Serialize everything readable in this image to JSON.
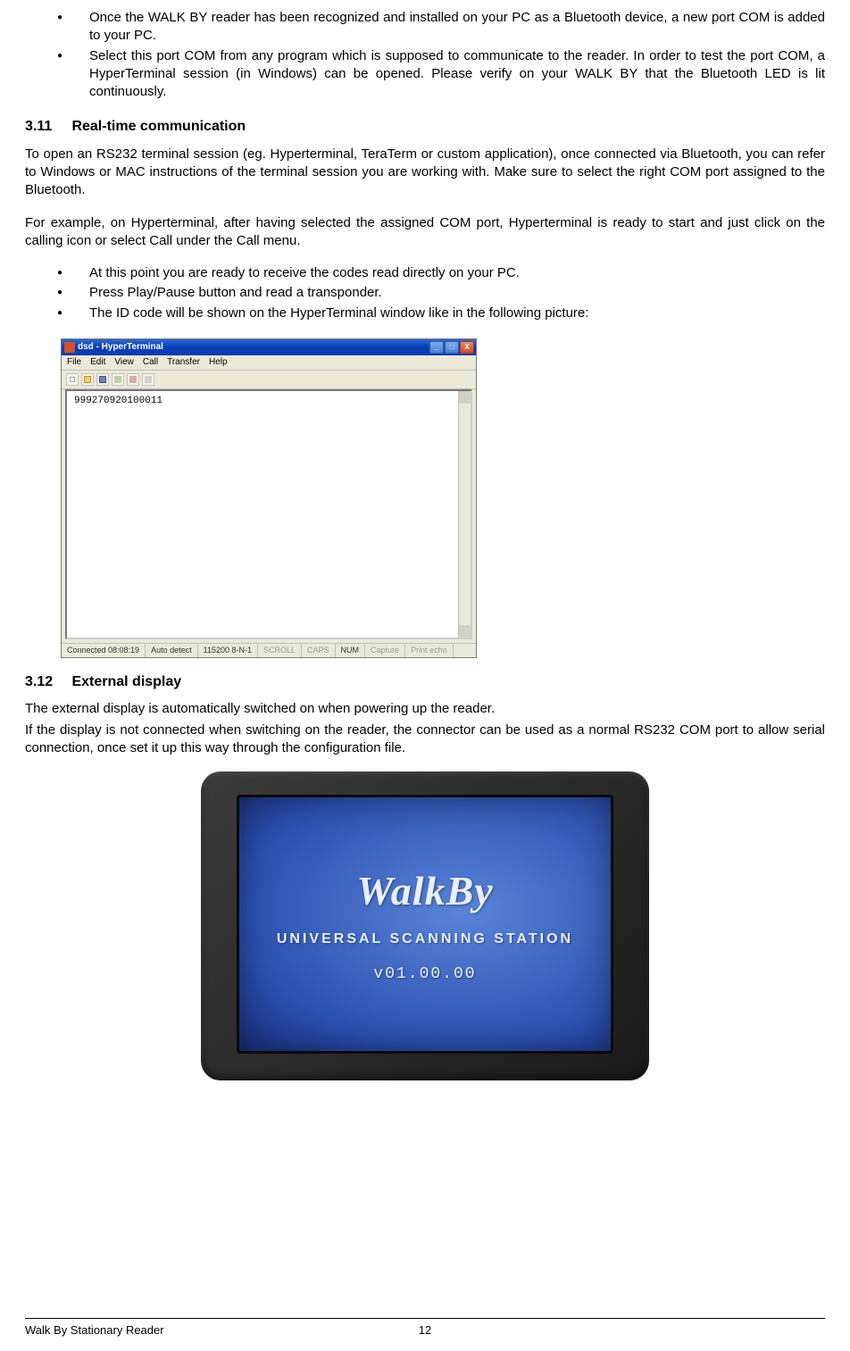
{
  "top_bullets": [
    "Once the WALK BY reader has been recognized and installed on your PC as a Bluetooth device, a new port COM is added to your PC.",
    "Select this port COM from any program which is supposed to communicate to the reader. In order to test the port COM, a HyperTerminal session (in Windows) can be opened. Please verify on your WALK BY that the Bluetooth LED is lit continuously."
  ],
  "sec311": {
    "num": "3.11",
    "title": "Real-time communication"
  },
  "para311a": "To open an RS232 terminal session (eg. Hyperterminal, TeraTerm or custom application), once connected via Bluetooth, you can refer to Windows or MAC instructions of the terminal session you are working with. Make sure to select the right COM port assigned to the Bluetooth.",
  "para311b": "For example, on Hyperterminal, after having selected the assigned COM port, Hyperterminal is ready to start and just click on the calling icon or select Call under the Call menu.",
  "mid_bullets": [
    "At this point you are ready to receive the codes read directly on your PC.",
    "Press Play/Pause button and read a transponder.",
    "The ID code will be shown on the HyperTerminal window like in the following picture:"
  ],
  "hyperterm": {
    "title": "dsd - HyperTerminal",
    "menus": [
      "File",
      "Edit",
      "View",
      "Call",
      "Transfer",
      "Help"
    ],
    "content": "999270920100011",
    "status": {
      "conn": "Connected 08:08:19",
      "detect": "Auto detect",
      "params": "115200 8-N-1",
      "scroll": "SCROLL",
      "caps": "CAPS",
      "num": "NUM",
      "capture": "Capture",
      "echo": "Print echo"
    },
    "win_btns": {
      "min": "_",
      "max": "□",
      "close": "X"
    }
  },
  "sec312": {
    "num": "3.12",
    "title": "External display"
  },
  "para312a": "The external display is automatically switched on when powering up the reader.",
  "para312b": "If the display is not connected when switching on the reader, the connector can be used as a normal RS232 COM port to allow serial connection, once set it up this way through the configuration file.",
  "ext_disp": {
    "brand": "WalkBy",
    "sub": "UNIVERSAL SCANNING STATION",
    "ver": "v01.00.00"
  },
  "footer": {
    "left": "Walk By Stationary Reader",
    "page": "12"
  }
}
